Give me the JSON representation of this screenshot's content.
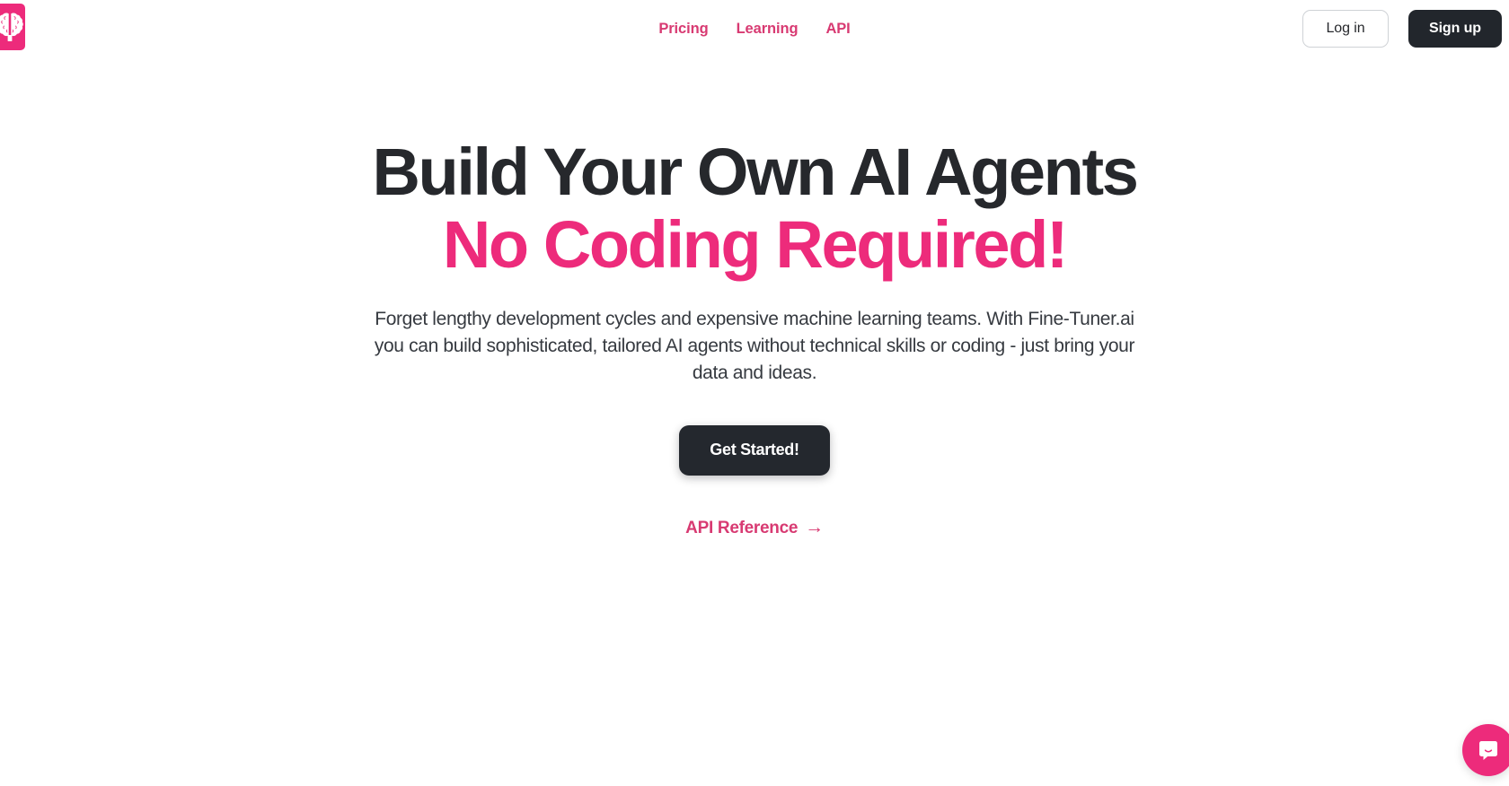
{
  "header": {
    "brand": {
      "icon": "brain-logo-icon",
      "bg_color": "#ED2B7B"
    },
    "nav": [
      {
        "label": "Pricing"
      },
      {
        "label": "Learning"
      },
      {
        "label": "API"
      }
    ],
    "actions": {
      "login_label": "Log in",
      "signup_label": "Sign up"
    },
    "nav_link_color": "#D83A72",
    "signup_bg_color": "#22262c"
  },
  "hero": {
    "title_line1": "Build Your Own AI Agents",
    "title_line2": "No Coding Required!",
    "title_color": "#26282c",
    "accent_color": "#ED2B7B",
    "subtitle": "Forget lengthy development cycles and expensive machine learning teams. With Fine-Tuner.ai you can build sophisticated, tailored AI agents without technical skills or coding - just bring your data and ideas.",
    "cta_label": "Get Started!",
    "cta_bg_color": "#24282e",
    "api_link_label": "API Reference",
    "api_link_arrow": "→",
    "api_link_color": "#D83A72"
  },
  "chat": {
    "icon": "chat-bubble-icon",
    "bg_color": "#ED2B7B"
  }
}
